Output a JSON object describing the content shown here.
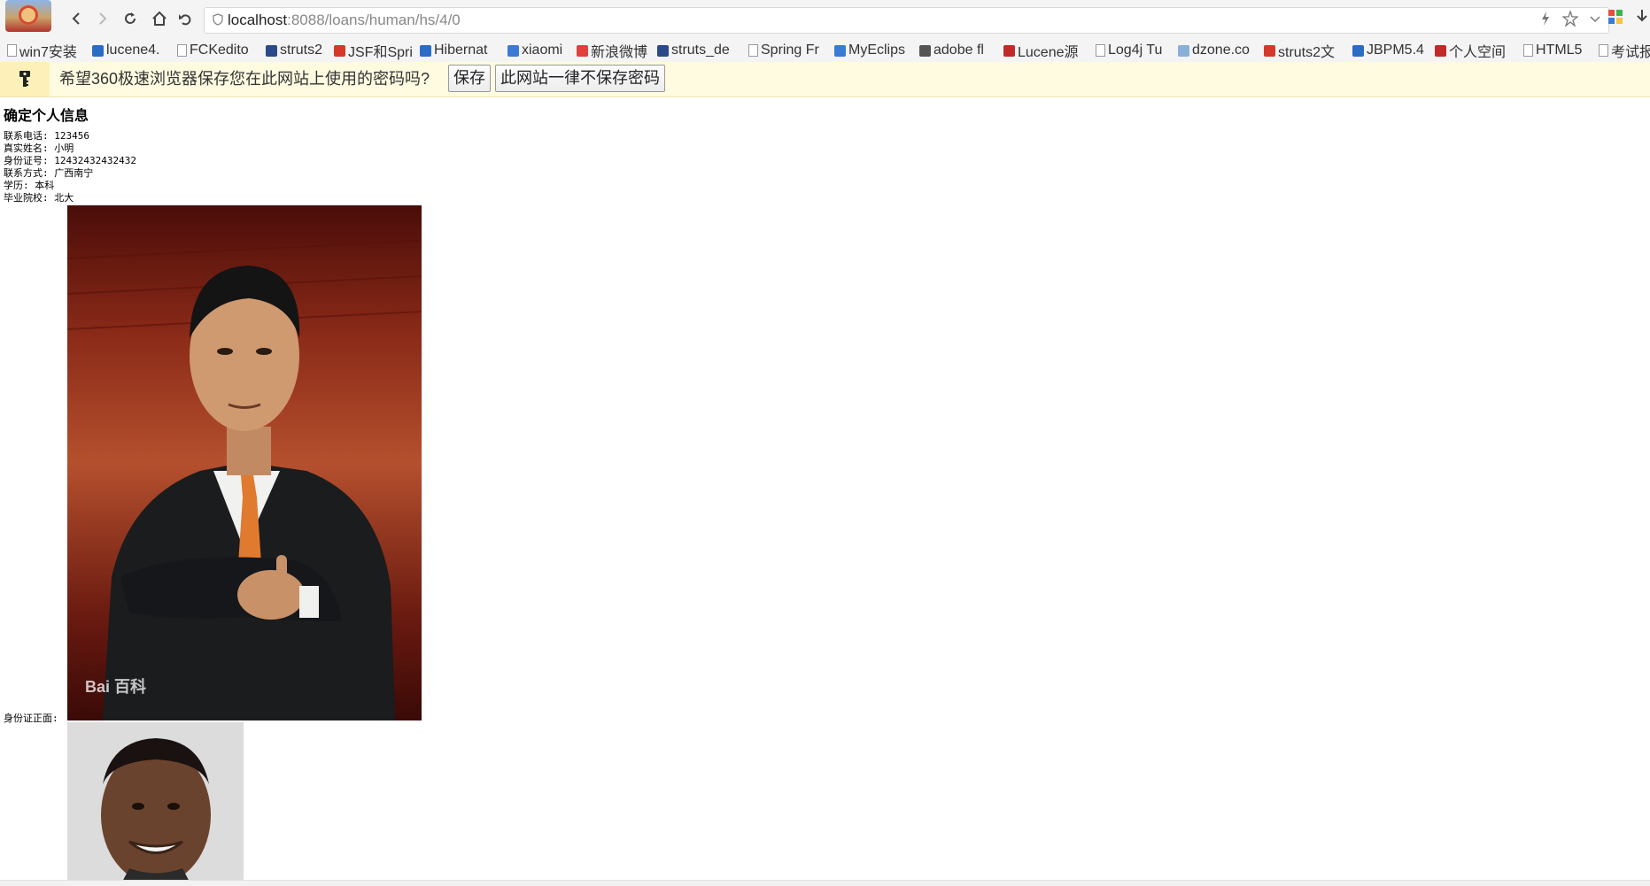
{
  "browser": {
    "url_host": "localhost",
    "url_path": ":8088/loans/human/hs/4/0"
  },
  "bookmarks": [
    {
      "label": "win7安装",
      "color": "#ffffff"
    },
    {
      "label": "lucene4.",
      "color": "#2b6cc4"
    },
    {
      "label": "FCKedito",
      "color": "#ffffff"
    },
    {
      "label": "struts2",
      "color": "#2a4a8a"
    },
    {
      "label": "JSF和Spri",
      "color": "#d43a2a"
    },
    {
      "label": "Hibernat",
      "color": "#2b6cc4"
    },
    {
      "label": "xiaomi",
      "color": "#3a7bd5"
    },
    {
      "label": "新浪微博",
      "color": "#e0413c"
    },
    {
      "label": "struts_de",
      "color": "#2a4a8a"
    },
    {
      "label": "Spring Fr",
      "color": "#ffffff"
    },
    {
      "label": "MyEclips",
      "color": "#3a7bd5"
    },
    {
      "label": "adobe fl",
      "color": "#555555"
    },
    {
      "label": "Lucene源",
      "color": "#c22a2a"
    },
    {
      "label": "Log4j Tu",
      "color": "#ffffff"
    },
    {
      "label": "dzone.co",
      "color": "#8ab0d8"
    },
    {
      "label": "struts2文",
      "color": "#d43a2a"
    },
    {
      "label": "JBPM5.4",
      "color": "#2b6cc4"
    },
    {
      "label": "个人空间",
      "color": "#c22a2a"
    },
    {
      "label": "HTML5",
      "color": "#ffffff"
    },
    {
      "label": "考试报",
      "color": "#ffffff"
    }
  ],
  "password_bar": {
    "message": "希望360极速浏览器保存您在此网站上使用的密码吗?",
    "save_button": "保存",
    "never_button": "此网站一律不保存密码"
  },
  "page": {
    "title": "确定个人信息",
    "fields": [
      {
        "label": "联系电话:",
        "value": "123456"
      },
      {
        "label": "真实姓名:",
        "value": "小明"
      },
      {
        "label": "身份证号:",
        "value": "12432432432432"
      },
      {
        "label": "联系方式:",
        "value": "广西南宁"
      },
      {
        "label": "学历:",
        "value": "本科"
      },
      {
        "label": "毕业院校:",
        "value": "北大"
      }
    ],
    "id_front_label": "身份证正面:",
    "watermark": "Bai 百科"
  }
}
